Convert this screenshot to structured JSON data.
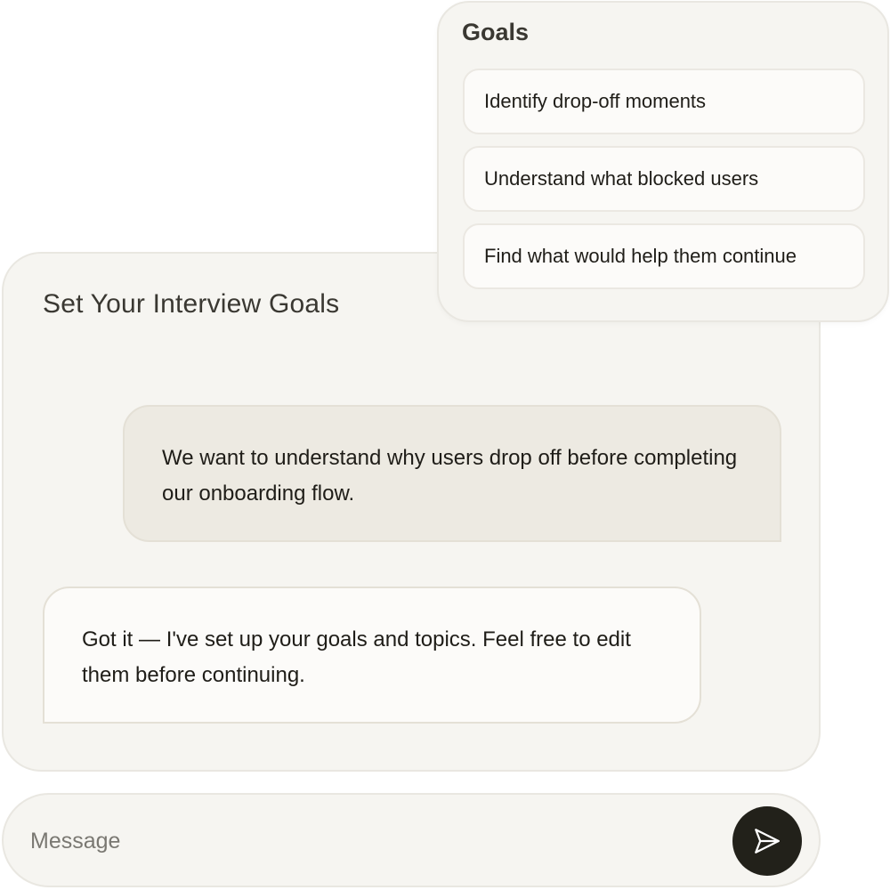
{
  "chat": {
    "title": "Set Your Interview Goals",
    "messages": [
      {
        "role": "user",
        "text": "We want to understand why users drop off before completing our onboarding flow."
      },
      {
        "role": "assistant",
        "text": "Got it — I've set up your goals and topics. Feel free to edit them before continuing."
      }
    ]
  },
  "goals": {
    "title": "Goals",
    "items": [
      {
        "label": "Identify drop-off moments"
      },
      {
        "label": "Understand what blocked users"
      },
      {
        "label": "Find what would help them continue"
      }
    ]
  },
  "composer": {
    "placeholder": "Message",
    "value": "",
    "send_icon": "send-icon"
  },
  "colors": {
    "card_background": "#f6f5f1",
    "user_bubble": "#edeae2",
    "assistant_bubble": "#fcfbf9",
    "send_button": "#22211a"
  }
}
